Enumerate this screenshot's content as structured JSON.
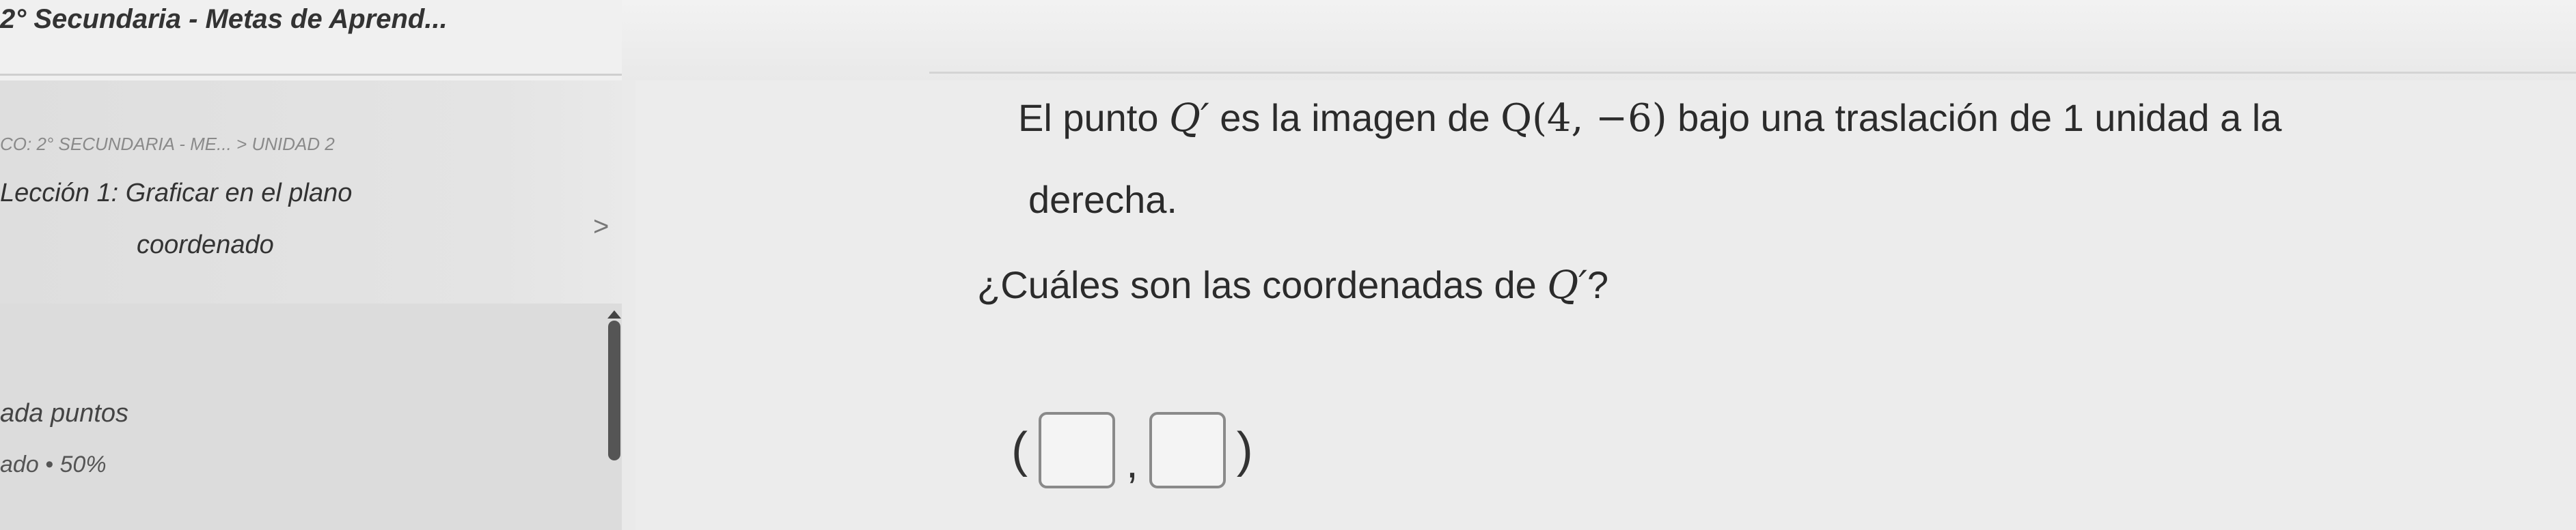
{
  "window": {
    "title": "2° Secundaria - Metas de Aprend..."
  },
  "sidebar": {
    "breadcrumb": "CO: 2° SECUNDARIA - ME... > UNIDAD 2",
    "lesson": {
      "line1": "Lección 1: Graficar en el plano",
      "line2": "coordenado",
      "chevron": ">"
    },
    "progress": {
      "label": "ada puntos",
      "status": "ado • 50%"
    },
    "collapse_arrow": "<"
  },
  "problem": {
    "line1_prefix": "El punto ",
    "point_name": "Q′",
    "line1_middle": " es la imagen de ",
    "point_coords": "Q(4, −6)",
    "line1_suffix": " bajo una traslación de 1 unidad a la",
    "line2": "derecha.",
    "question_prefix": "¿Cuáles son las coordenadas de ",
    "question_point": "Q′",
    "question_suffix": "?"
  },
  "answer": {
    "open_paren": "(",
    "comma": ",",
    "close_paren": ")"
  }
}
